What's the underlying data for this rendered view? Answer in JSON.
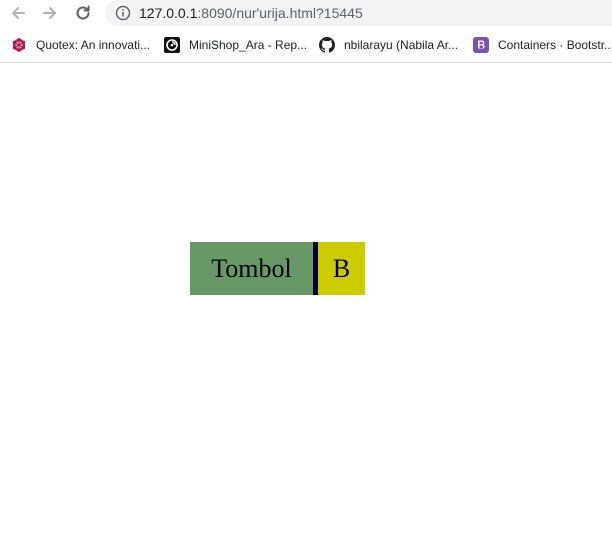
{
  "browser": {
    "url_host": "127.0.0.1",
    "url_rest": ":8090/nur'urija.html?15445",
    "bookmarks": [
      {
        "label": "Quotex: An innovati...",
        "icon": "quotex-icon"
      },
      {
        "label": "MiniShop_Ara - Rep...",
        "icon": "minishop-icon"
      },
      {
        "label": "nbilarayu (Nabila Ar...",
        "icon": "github-icon"
      },
      {
        "label": "Containers · Bootstr...",
        "icon": "bootstrap-icon"
      }
    ]
  },
  "page": {
    "tombol_label": "Tombol",
    "b_label": "B"
  },
  "colors": {
    "tombol_bg": "#669966",
    "divider": "#000033",
    "b_bg": "#cccc00"
  }
}
